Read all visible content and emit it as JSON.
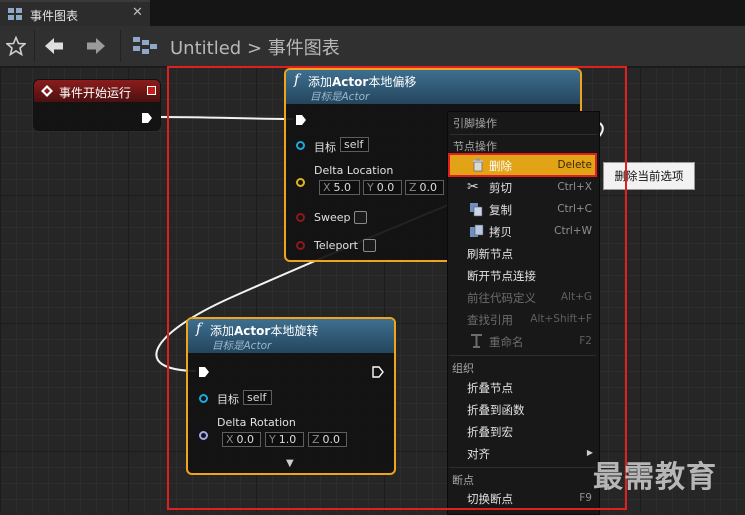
{
  "tab": {
    "title": "事件图表",
    "close_glyph": "✕"
  },
  "toolbar": {
    "breadcrumb_root": "Untitled",
    "breadcrumb_sep": ">",
    "breadcrumb_current": "事件图表"
  },
  "event_node": {
    "title": "事件开始运行"
  },
  "node_offset": {
    "title_prefix": "添加",
    "title_bold": "Actor",
    "title_suffix": "本地偏移",
    "subtitle": "目标是Actor",
    "target_label": "目标",
    "target_value": "self",
    "location_label": "Delta Location",
    "x_label": "X",
    "x_value": "5.0",
    "y_label": "Y",
    "y_value": "0.0",
    "z_label": "Z",
    "z_value": "0.0",
    "sweep_label": "Sweep",
    "teleport_label": "Teleport"
  },
  "node_rotation": {
    "title_prefix": "添加",
    "title_bold": "Actor",
    "title_suffix": "本地旋转",
    "subtitle": "目标是Actor",
    "target_label": "目标",
    "target_value": "self",
    "rotation_label": "Delta Rotation",
    "x_label": "X",
    "x_value": "0.0",
    "y_label": "Y",
    "y_value": "1.0",
    "z_label": "Z",
    "z_value": "0.0",
    "expand_glyph": "▼"
  },
  "menu": {
    "section_pin": "引脚操作",
    "section_node": "节点操作",
    "items_node": [
      {
        "label": "删除",
        "key": "Delete"
      },
      {
        "label": "剪切",
        "key": "Ctrl+X"
      },
      {
        "label": "复制",
        "key": "Ctrl+C"
      },
      {
        "label": "拷贝",
        "key": "Ctrl+W"
      },
      {
        "label": "刷新节点",
        "key": ""
      },
      {
        "label": "断开节点连接",
        "key": ""
      },
      {
        "label": "前往代码定义",
        "key": "Alt+G"
      },
      {
        "label": "查找引用",
        "key": "Alt+Shift+F"
      },
      {
        "label": "重命名",
        "key": "F2"
      }
    ],
    "section_org": "组织",
    "items_org": [
      {
        "label": "折叠节点"
      },
      {
        "label": "折叠到函数"
      },
      {
        "label": "折叠到宏"
      },
      {
        "label": "对齐",
        "arrow": "▶"
      }
    ],
    "section_bp": "断点",
    "items_bp": [
      {
        "label": "切换断点",
        "key": "F9"
      }
    ]
  },
  "tooltip": "删除当前选项",
  "watermark": "最需教育",
  "colors": {
    "accent": "#e2a416",
    "highlight_outline": "#e02020",
    "function_header": "#3e6f8f"
  }
}
